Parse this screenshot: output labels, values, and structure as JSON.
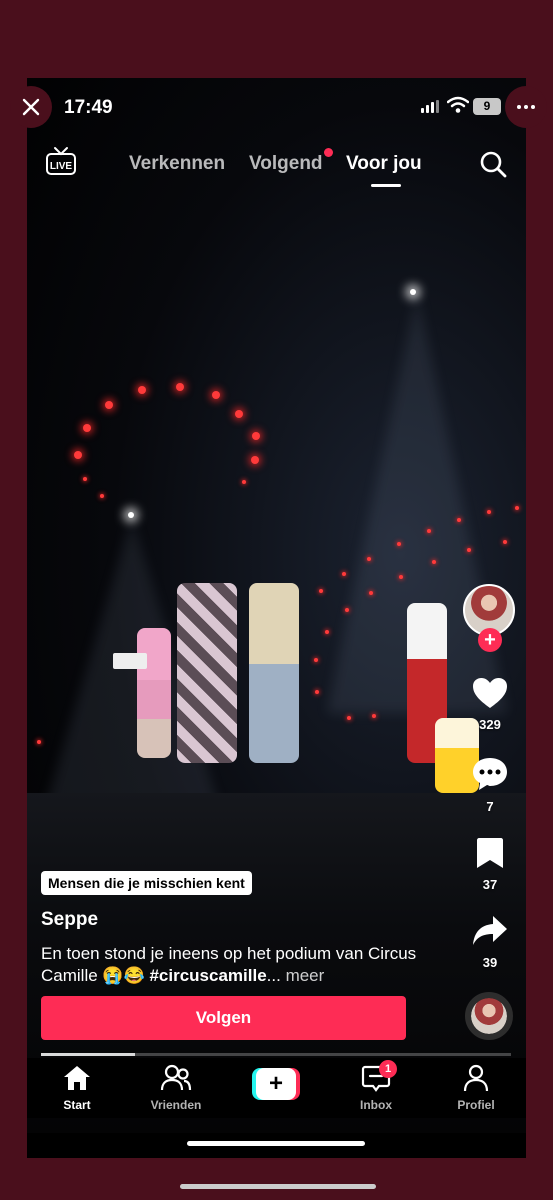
{
  "status_bar": {
    "time": "17:49",
    "battery": "9"
  },
  "top_nav": {
    "live_label": "LIVE",
    "tabs": [
      {
        "label": "Verkennen",
        "active": false
      },
      {
        "label": "Volgend",
        "active": false,
        "has_notification": true
      },
      {
        "label": "Voor jou",
        "active": true
      }
    ]
  },
  "rail": {
    "likes": "329",
    "comments": "7",
    "bookmarks": "37",
    "shares": "39"
  },
  "post": {
    "suggestion_tag": "Mensen die je misschien kent",
    "username": "Seppe",
    "description_text": "En toen stond je ineens op het podium van Circus Camille 😭😂 ",
    "hashtag": "#circuscamille",
    "ellipsis": "...",
    "more": " meer",
    "follow_button": "Volgen",
    "progress_fraction": 0.2
  },
  "tab_bar": {
    "items": [
      {
        "label": "Start",
        "icon": "home-icon",
        "active": true
      },
      {
        "label": "Vrienden",
        "icon": "friends-icon",
        "active": false
      },
      {
        "label": "",
        "icon": "create-icon",
        "active": false
      },
      {
        "label": "Inbox",
        "icon": "inbox-icon",
        "active": false,
        "badge": "1"
      },
      {
        "label": "Profiel",
        "icon": "profile-icon",
        "active": false
      }
    ]
  },
  "colors": {
    "accent": "#fe2c55",
    "cyan": "#25f4ee",
    "frame": "#4a0f1c"
  }
}
